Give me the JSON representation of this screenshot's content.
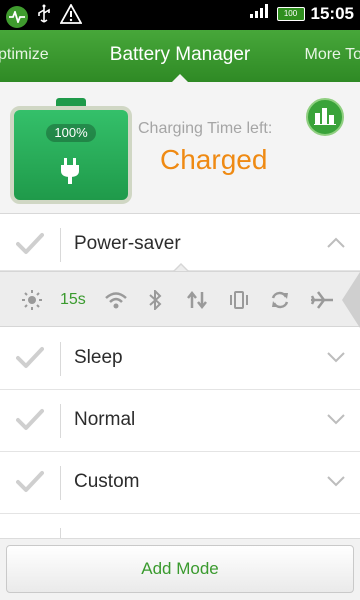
{
  "status_bar": {
    "time": "15:05",
    "battery_text": "100",
    "icons": [
      "app-activity-icon",
      "usb-icon",
      "warning-icon",
      "signal-icon",
      "battery-icon"
    ]
  },
  "tabs": {
    "left": "ptimize",
    "center": "Battery Manager",
    "right": "More To"
  },
  "battery": {
    "percent_label": "100%",
    "charging_label": "Charging Time left:",
    "charging_value": "Charged",
    "level_percent": 100
  },
  "modes": [
    {
      "label": "Power-saver",
      "expanded": true
    },
    {
      "label": "Sleep",
      "expanded": false
    },
    {
      "label": "Normal",
      "expanded": false
    },
    {
      "label": "Custom",
      "expanded": false
    }
  ],
  "quick_settings": {
    "timeout_label": "15s",
    "icons": [
      "brightness-icon",
      "screen-timeout",
      "wifi-icon",
      "bluetooth-icon",
      "data-sync-icon",
      "vibrate-icon",
      "auto-sync-icon",
      "airplane-icon"
    ]
  },
  "footer": {
    "add_mode_label": "Add Mode"
  },
  "colors": {
    "accent_green": "#3a9a2e",
    "header_green": "#47a73a",
    "charged_orange": "#ef8a13"
  }
}
